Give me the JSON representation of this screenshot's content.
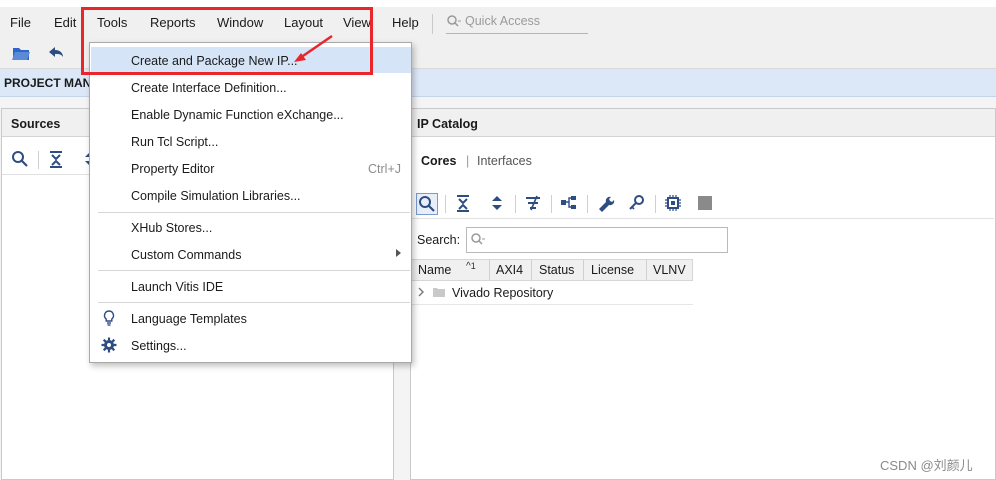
{
  "menubar": {
    "items": [
      "File",
      "Edit",
      "Tools",
      "Reports",
      "Window",
      "Layout",
      "View",
      "Help"
    ],
    "quick_access_placeholder": "Quick Access"
  },
  "project_manager": {
    "label": "PROJECT MANA"
  },
  "sources_panel": {
    "title": "Sources"
  },
  "ip_catalog": {
    "title": "IP Catalog",
    "tabs": [
      "Cores",
      "Interfaces"
    ],
    "search_label": "Search:",
    "search_placeholder": "Q-",
    "columns": [
      "Name",
      "AXI4",
      "Status",
      "License",
      "VLNV"
    ],
    "sort_indicator": "1",
    "rows": [
      "Vivado Repository"
    ]
  },
  "tools_menu": {
    "items": [
      {
        "label": "Create and Package New IP...",
        "highlighted": true
      },
      {
        "label": "Create Interface Definition..."
      },
      {
        "label": "Enable Dynamic Function eXchange..."
      },
      {
        "label": "Run Tcl Script..."
      },
      {
        "label": "Property Editor",
        "shortcut": "Ctrl+J"
      },
      {
        "label": "Compile Simulation Libraries..."
      },
      {
        "label": "XHub Stores..."
      },
      {
        "label": "Custom Commands",
        "submenu": true
      },
      {
        "label": "Launch Vitis IDE"
      },
      {
        "label": "Language Templates",
        "icon": "lightbulb-icon"
      },
      {
        "label": "Settings...",
        "icon": "gear-icon"
      }
    ]
  },
  "annotation": {
    "color": "#e8262c"
  },
  "watermark": "CSDN @刘颜儿",
  "colors": {
    "menu_highlight": "#d6e4f7",
    "pm_bar": "#dce8f8",
    "accent_blue": "#2e66c7"
  }
}
